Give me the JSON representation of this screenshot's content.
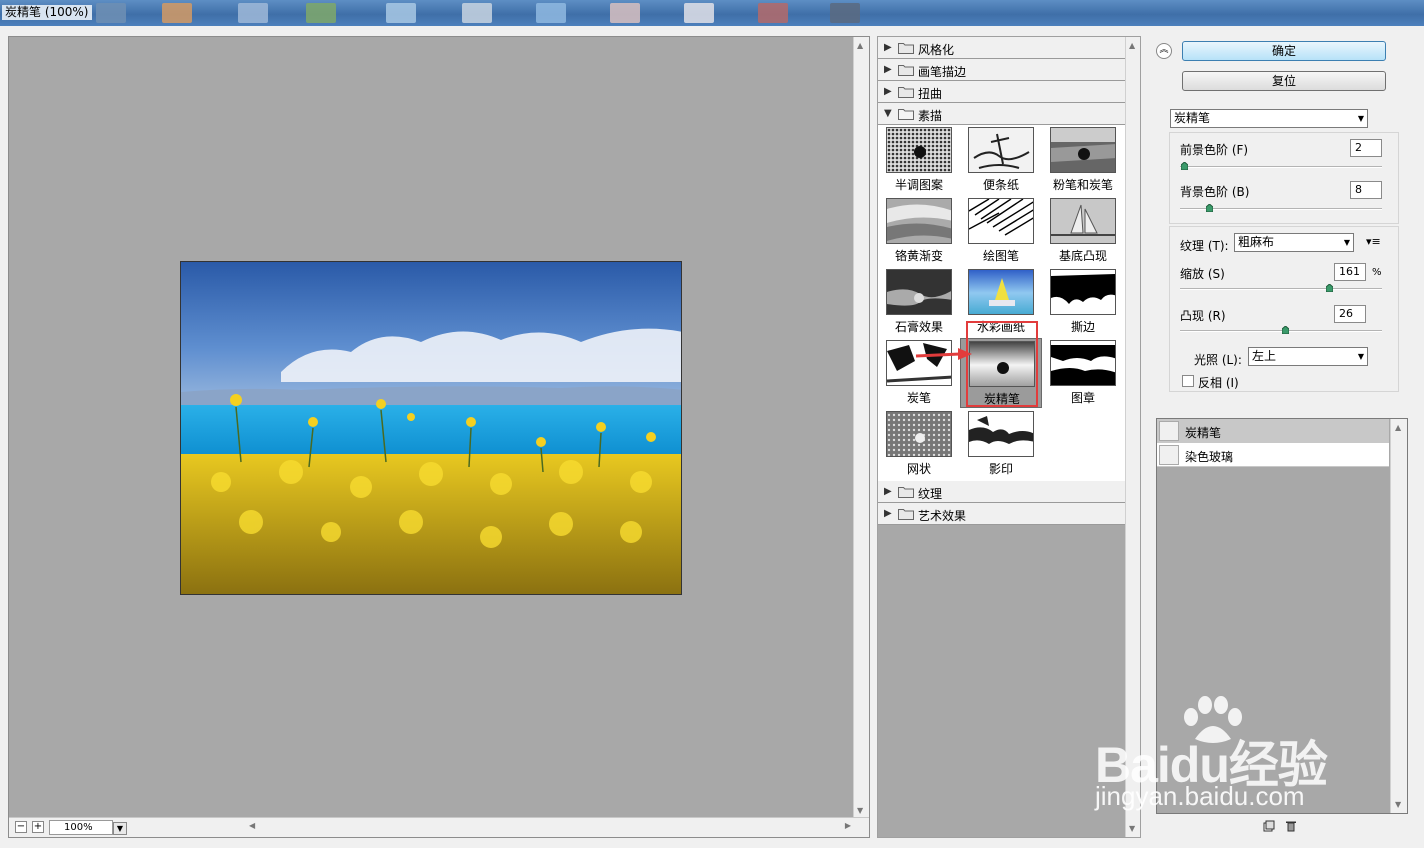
{
  "window": {
    "title": "炭精笔 (100%)"
  },
  "preview": {
    "zoom": "100%",
    "zoom_out": "−",
    "zoom_in": "+"
  },
  "categories_top": [
    {
      "label": "风格化",
      "expanded": false
    },
    {
      "label": "画笔描边",
      "expanded": false
    },
    {
      "label": "扭曲",
      "expanded": false
    },
    {
      "label": "素描",
      "expanded": true
    }
  ],
  "categories_bottom": [
    {
      "label": "纹理",
      "expanded": false
    },
    {
      "label": "艺术效果",
      "expanded": false
    }
  ],
  "sketch_filters": [
    {
      "name": "半调图案",
      "icon": "halftone-thumb-icon"
    },
    {
      "name": "便条纸",
      "icon": "note-paper-thumb-icon"
    },
    {
      "name": "粉笔和炭笔",
      "icon": "chalk-charcoal-thumb-icon"
    },
    {
      "name": "铬黄渐变",
      "icon": "chrome-thumb-icon"
    },
    {
      "name": "绘图笔",
      "icon": "graphic-pen-thumb-icon"
    },
    {
      "name": "基底凸现",
      "icon": "bas-relief-thumb-icon"
    },
    {
      "name": "石膏效果",
      "icon": "plaster-thumb-icon"
    },
    {
      "name": "水彩画纸",
      "icon": "water-paper-thumb-icon"
    },
    {
      "name": "撕边",
      "icon": "torn-edges-thumb-icon"
    },
    {
      "name": "炭笔",
      "icon": "charcoal-thumb-icon"
    },
    {
      "name": "炭精笔",
      "icon": "conte-crayon-thumb-icon",
      "selected": true
    },
    {
      "name": "图章",
      "icon": "stamp-thumb-icon"
    },
    {
      "name": "网状",
      "icon": "reticulation-thumb-icon"
    },
    {
      "name": "影印",
      "icon": "photocopy-thumb-icon"
    }
  ],
  "settings": {
    "ok_label": "确定",
    "reset_label": "复位",
    "filter_select": "炭精笔",
    "foreground_label": "前景色阶 (F)",
    "foreground_value": "2",
    "foreground_level": 2,
    "background_label": "背景色阶 (B)",
    "background_value": "8",
    "background_level": 8,
    "texture_label": "纹理 (T):",
    "texture_value": "粗麻布",
    "scale_label": "缩放 (S)",
    "scale_value": "161",
    "scale_unit": "%",
    "relief_label": "凸现 (R)",
    "relief_value": "26",
    "light_label": "光照 (L):",
    "light_value": "左上",
    "invert_label": "反相 (I)",
    "invert_checked": false
  },
  "layers": [
    {
      "label": "炭精笔",
      "active": true
    },
    {
      "label": "染色玻璃",
      "active": false
    }
  ],
  "watermark": {
    "brand": "Baidu经验",
    "url": "jingyan.baidu.com"
  },
  "colors": {
    "preview_bg": "#a8a8a8",
    "highlight": "#e23c3c",
    "ok_button": "#b7e2f8"
  }
}
